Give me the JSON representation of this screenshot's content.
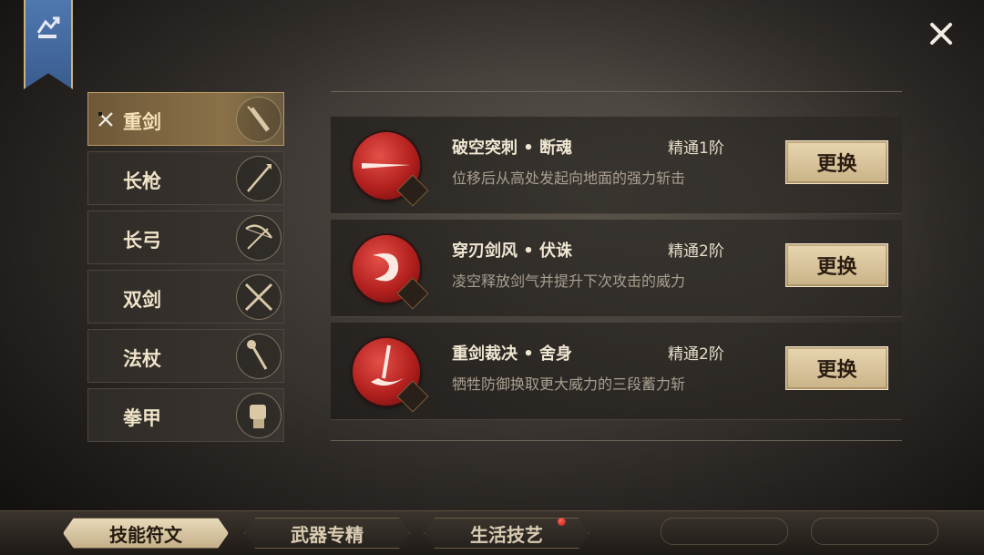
{
  "weapons": [
    {
      "label": "重剑",
      "active": true,
      "icon": "greatsword-icon"
    },
    {
      "label": "长枪",
      "active": false,
      "icon": "spear-icon"
    },
    {
      "label": "长弓",
      "active": false,
      "icon": "longbow-icon"
    },
    {
      "label": "双剑",
      "active": false,
      "icon": "dual-swords-icon"
    },
    {
      "label": "法杖",
      "active": false,
      "icon": "staff-icon"
    },
    {
      "label": "拳甲",
      "active": false,
      "icon": "gauntlet-icon"
    }
  ],
  "skills": [
    {
      "name": "破空突刺 • 断魂",
      "level": "精通1阶",
      "desc": "位移后从高处发起向地面的强力斩击",
      "button": "更换"
    },
    {
      "name": "穿刃剑风 • 伏诛",
      "level": "精通2阶",
      "desc": "凌空释放剑气并提升下次攻击的威力",
      "button": "更换"
    },
    {
      "name": "重剑裁决 • 舍身",
      "level": "精通2阶",
      "desc": "牺牲防御换取更大威力的三段蓄力斩",
      "button": "更换"
    }
  ],
  "tabs": [
    {
      "label": "技能符文",
      "active": true
    },
    {
      "label": "武器专精",
      "active": false
    },
    {
      "label": "生活技艺",
      "active": false,
      "notification": true
    }
  ],
  "colors": {
    "accent": "#c9b287",
    "skill_red": "#b2201e",
    "banner_blue": "#4f78b0"
  }
}
